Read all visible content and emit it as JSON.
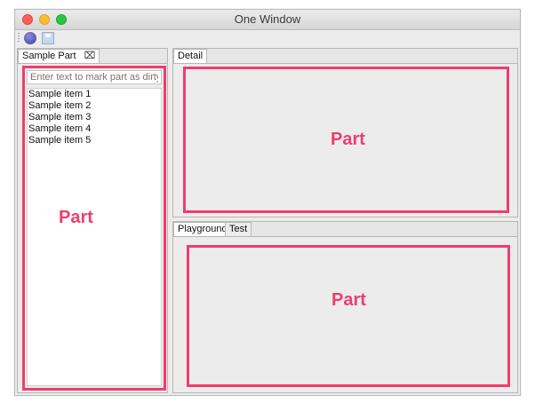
{
  "window": {
    "title": "One Window"
  },
  "left_stack": {
    "tab": {
      "label": "Sample Part",
      "close": "⌧"
    },
    "search_placeholder": "Enter text to mark part as dirty",
    "items": [
      "Sample item 1",
      "Sample item 2",
      "Sample item 3",
      "Sample item 4",
      "Sample item 5"
    ],
    "part_label": "Part"
  },
  "top_right_stack": {
    "tab": {
      "label": "Detail"
    },
    "part_label": "Part"
  },
  "bottom_right_stack": {
    "tabs": [
      {
        "label": "Playground"
      },
      {
        "label": "Test"
      }
    ],
    "part_label": "Part"
  },
  "colors": {
    "part_outline": "#ee3d6e"
  }
}
